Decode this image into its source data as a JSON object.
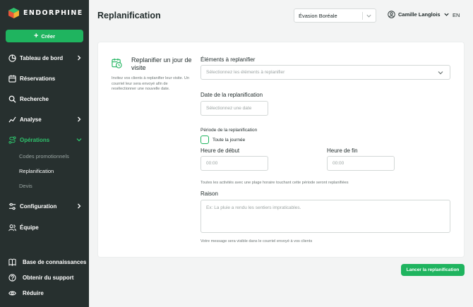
{
  "brand": {
    "name": "ENDORPHINE",
    "accent": "#1fb45f",
    "sidebar_bg": "#27302f"
  },
  "sidebar": {
    "create_label": "Créer",
    "items": [
      {
        "label": "Tableau de bord",
        "icon": "pie-chart-icon",
        "has_chevron": true
      },
      {
        "label": "Réservations",
        "icon": "calendar-icon",
        "has_chevron": false
      },
      {
        "label": "Recherche",
        "icon": "search-icon",
        "has_chevron": false
      },
      {
        "label": "Analyse",
        "icon": "chart-icon",
        "has_chevron": true
      },
      {
        "label": "Opérations",
        "icon": "route-icon",
        "has_chevron": true,
        "expanded": true
      },
      {
        "label": "Configuration",
        "icon": "sliders-icon",
        "has_chevron": true
      },
      {
        "label": "Équipe",
        "icon": "users-icon",
        "has_chevron": false
      }
    ],
    "sub_items": [
      "Codes promotionnels",
      "Replanification",
      "Devis"
    ],
    "footer": [
      {
        "label": "Base de connaissances",
        "icon": "book-icon"
      },
      {
        "label": "Obtenir du support",
        "icon": "help-icon"
      },
      {
        "label": "Réduire",
        "icon": "eye-icon"
      }
    ]
  },
  "header": {
    "title": "Replanification",
    "organization": "Évasion Boréale",
    "user": "Camille Langlois",
    "language": "EN"
  },
  "form": {
    "side_title": "Replanifier un jour de visite",
    "side_desc": "Invitez vos clients à replanifier leur visite. Un courriel leur sera envoyé afin de resélectionner une nouvelle date.",
    "elements_label": "Éléments à replanifier",
    "elements_placeholder": "Sélectionnez les éléments à replanifier",
    "date_label": "Date de la replanification",
    "date_placeholder": "Sélectionnez une date",
    "period_label": "Période de la replanification",
    "all_day_label": "Toute la journée",
    "start_label": "Heure de début",
    "start_value": "00:00",
    "end_label": "Heure de fin",
    "end_value": "00:00",
    "period_hint": "Toutes les activités avec une plage horaire touchant cette période seront replanifiées",
    "reason_label": "Raison",
    "reason_placeholder": "Ex: La pluie a rendu les sentiers impraticables.",
    "reason_hint": "Votre message sera visible dans le courriel envoyé à vos clients",
    "submit_label": "Lancer la replanification"
  }
}
